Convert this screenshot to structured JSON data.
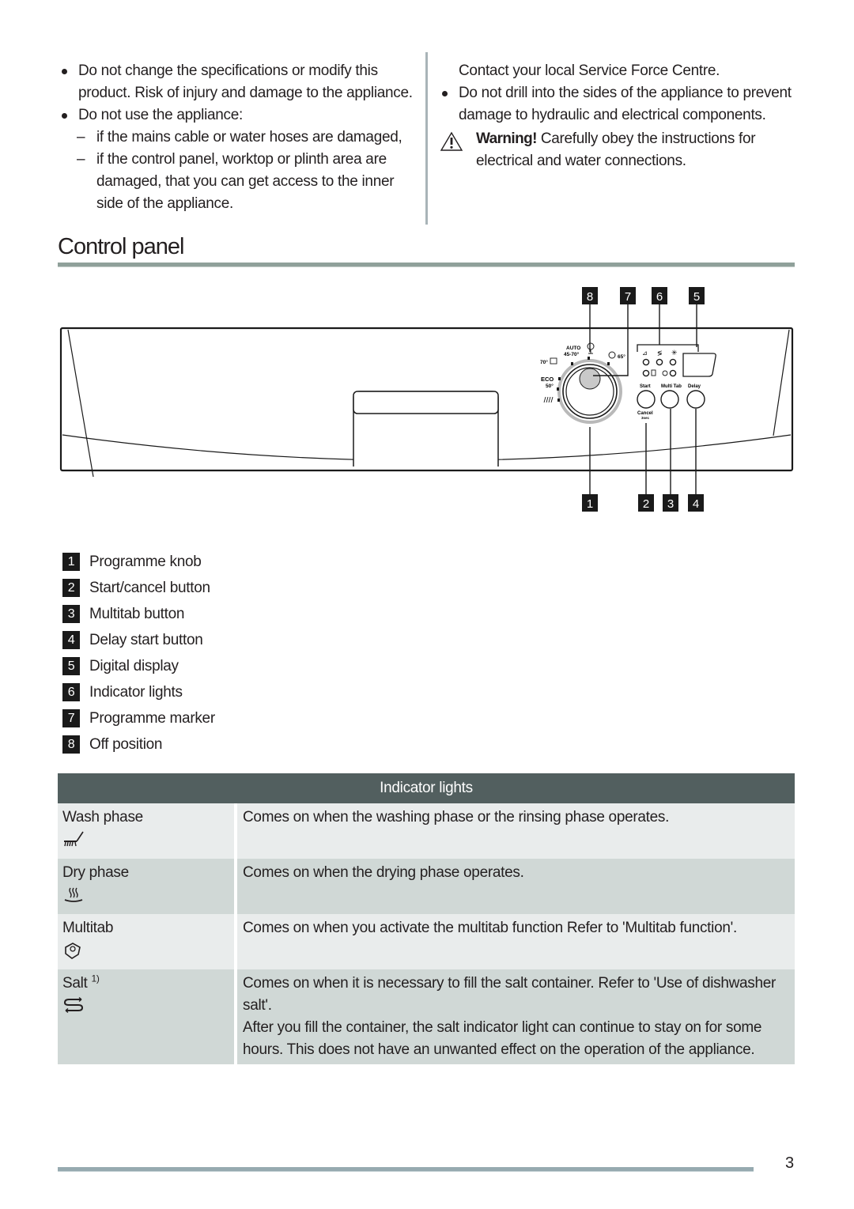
{
  "left_column": {
    "bullets": [
      "Do not change the specifications or modify this product. Risk of injury and damage to the appliance.",
      "Do not use the appliance:"
    ],
    "sub_items": [
      "if the mains cable or water hoses are damaged,",
      "if the control panel, worktop or plinth area are damaged, that you can get access to the inner side of the appliance."
    ]
  },
  "right_column": {
    "continuation": "Contact your local Service Force Centre.",
    "bullet": "Do not drill into the sides of the appliance to prevent damage to hydraulic and electrical components.",
    "warning_label": "Warning!",
    "warning_text": "Carefully obey the instructions for electrical and water connections."
  },
  "section": {
    "title": "Control panel"
  },
  "diagram": {
    "callouts_top": [
      "8",
      "7",
      "6",
      "5"
    ],
    "callouts_bottom": [
      "1",
      "2",
      "3",
      "4"
    ],
    "dial_labels": {
      "auto": "AUTO",
      "auto_temp": "45-70°",
      "intensive": "70°",
      "eco": "ECO",
      "eco_temp": "50°",
      "quick": "65°"
    },
    "buttons": {
      "start": "Start",
      "cancel": "Cancel",
      "cancel_sub": "3sec",
      "multitab": "Multi Tab",
      "delay": "Delay"
    }
  },
  "legend": [
    {
      "num": "1",
      "label": "Programme knob"
    },
    {
      "num": "2",
      "label": "Start/cancel button"
    },
    {
      "num": "3",
      "label": "Multitab button"
    },
    {
      "num": "4",
      "label": "Delay start button"
    },
    {
      "num": "5",
      "label": "Digital display"
    },
    {
      "num": "6",
      "label": "Indicator lights"
    },
    {
      "num": "7",
      "label": "Programme marker"
    },
    {
      "num": "8",
      "label": "Off position"
    }
  ],
  "indicator_table": {
    "title": "Indicator lights",
    "rows": [
      {
        "name": "Wash phase",
        "icon": "wash-phase-icon",
        "desc": [
          "Comes on when the washing phase or the rinsing phase operates."
        ]
      },
      {
        "name": "Dry phase",
        "icon": "dry-phase-icon",
        "desc": [
          "Comes on when the drying phase operates."
        ]
      },
      {
        "name": "Multitab",
        "icon": "multitab-icon",
        "desc": [
          "Comes on when you activate the multitab function Refer to 'Multitab function'."
        ]
      },
      {
        "name": "Salt",
        "footnote": "1)",
        "icon": "salt-icon",
        "desc": [
          "Comes on when it is necessary to fill the salt container. Refer to 'Use of dishwasher salt'.",
          "After you fill the container, the salt indicator light can continue to stay on for some hours. This does not have an unwanted effect on the operation of the appliance."
        ]
      }
    ]
  },
  "footer": {
    "page_number": "3"
  }
}
